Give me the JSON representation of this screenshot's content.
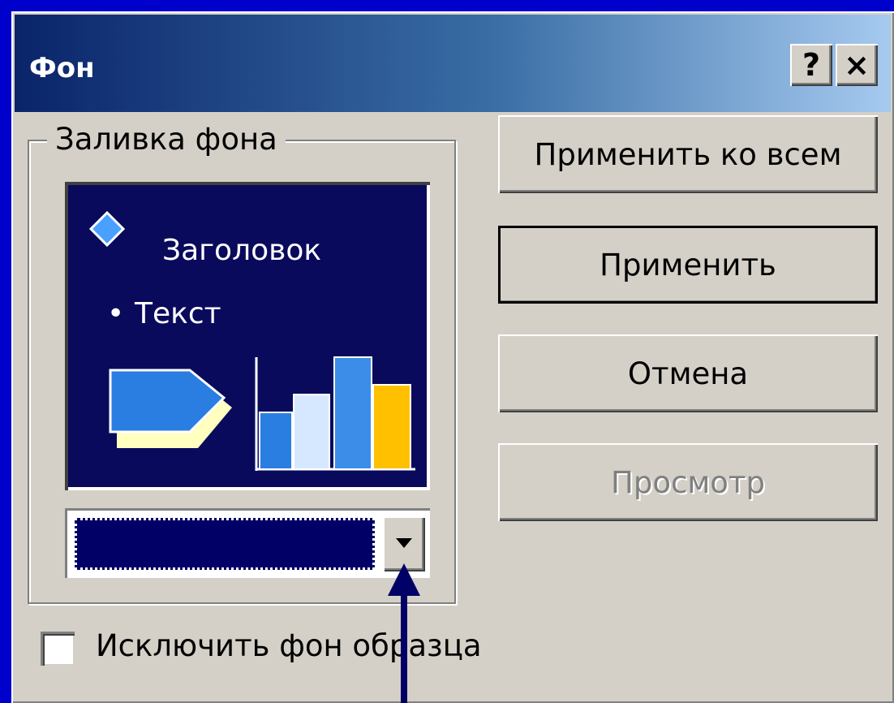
{
  "window": {
    "title": "Фон",
    "help_label": "?",
    "close_label": "×"
  },
  "fill_group": {
    "label": "Заливка фона",
    "preview": {
      "title_text": "Заголовок",
      "bullet": "•",
      "body_text": "Текст"
    },
    "color_value": "#000066"
  },
  "buttons": {
    "apply_all": "Применить ко всем",
    "apply": "Применить",
    "cancel": "Отмена",
    "preview": "Просмотр"
  },
  "exclude_checkbox": {
    "label": "Исключить фон образца",
    "checked": false
  },
  "colors": {
    "background": "#0000cc",
    "dialog_face": "#d4d0c8",
    "preview_background": "#0a0a5c",
    "arrow": "#000066"
  }
}
